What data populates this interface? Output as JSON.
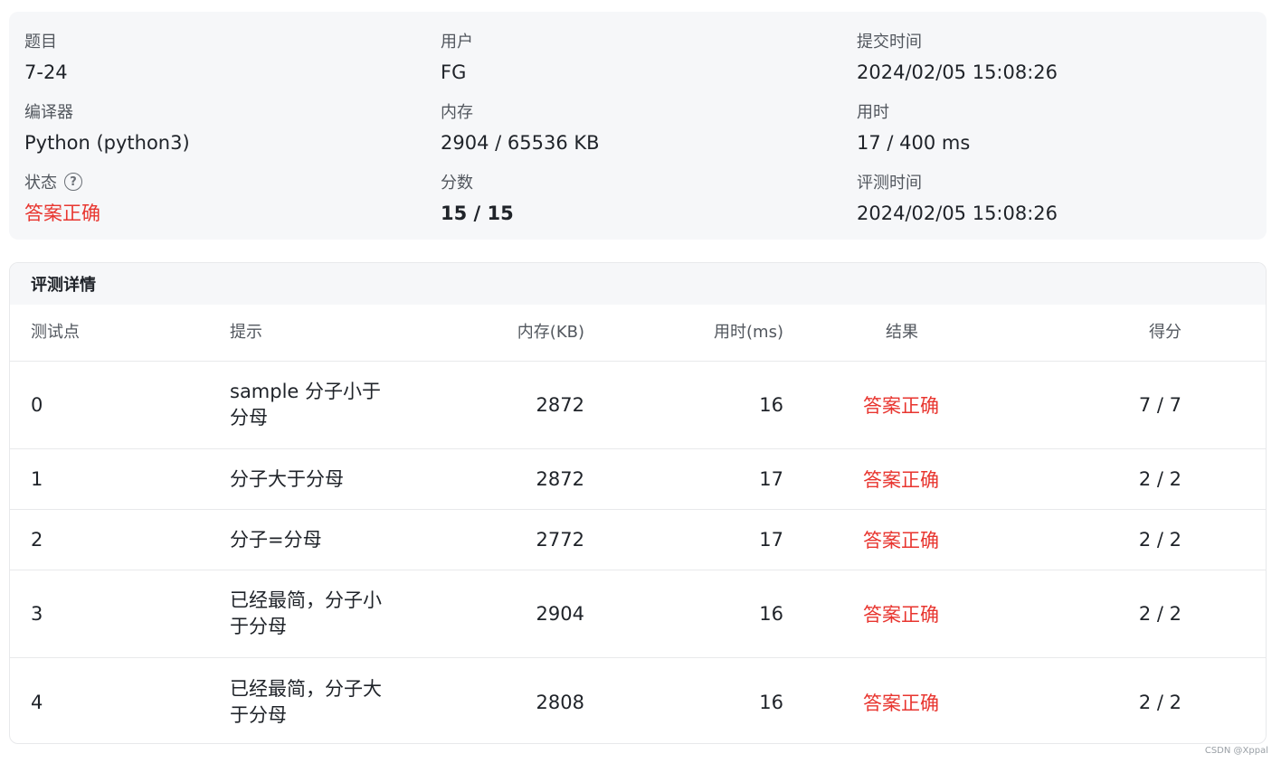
{
  "summary": {
    "problem": {
      "label": "题目",
      "value": "7-24"
    },
    "user": {
      "label": "用户",
      "value": "FG"
    },
    "submit_time": {
      "label": "提交时间",
      "value": "2024/02/05 15:08:26"
    },
    "compiler": {
      "label": "编译器",
      "value": "Python (python3)"
    },
    "memory": {
      "label": "内存",
      "value": "2904 / 65536 KB"
    },
    "time_used": {
      "label": "用时",
      "value": "17 / 400 ms"
    },
    "status": {
      "label": "状态",
      "help": "?",
      "value": "答案正确"
    },
    "score": {
      "label": "分数",
      "value": "15 / 15"
    },
    "judge_time": {
      "label": "评测时间",
      "value": "2024/02/05 15:08:26"
    }
  },
  "detail": {
    "title": "评测详情",
    "columns": {
      "id": "测试点",
      "hint": "提示",
      "memory": "内存(KB)",
      "time": "用时(ms)",
      "result": "结果",
      "score": "得分"
    },
    "rows": [
      {
        "id": "0",
        "hint": "sample 分子小于分母",
        "memory": "2872",
        "time": "16",
        "result": "答案正确",
        "score": "7 / 7"
      },
      {
        "id": "1",
        "hint": "分子大于分母",
        "memory": "2872",
        "time": "17",
        "result": "答案正确",
        "score": "2 / 2"
      },
      {
        "id": "2",
        "hint": "分子=分母",
        "memory": "2772",
        "time": "17",
        "result": "答案正确",
        "score": "2 / 2"
      },
      {
        "id": "3",
        "hint": "已经最简，分子小于分母",
        "memory": "2904",
        "time": "16",
        "result": "答案正确",
        "score": "2 / 2"
      },
      {
        "id": "4",
        "hint": "已经最简，分子大于分母",
        "memory": "2808",
        "time": "16",
        "result": "答案正确",
        "score": "2 / 2"
      }
    ]
  },
  "colors": {
    "accepted": "#e8352f",
    "panel_bg": "#f6f7f9",
    "border": "#e8e9eb"
  },
  "watermark": "CSDN @Xppal"
}
